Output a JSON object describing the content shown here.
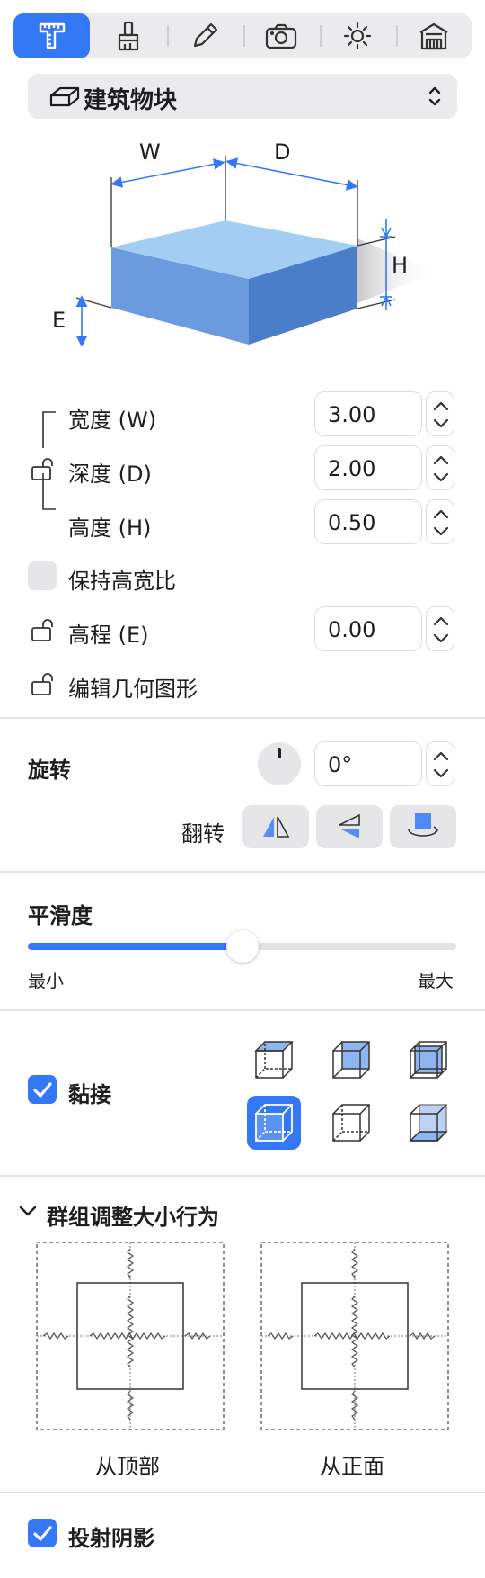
{
  "toolbar": {
    "tools": [
      {
        "icon": "measure-object-icon",
        "active": true
      },
      {
        "icon": "brush-icon",
        "active": false
      },
      {
        "icon": "pencil-icon",
        "active": false
      },
      {
        "icon": "camera-icon",
        "active": false
      },
      {
        "icon": "sun-icon",
        "active": false
      },
      {
        "icon": "storefront-icon",
        "active": false
      }
    ]
  },
  "object_type": {
    "label": "建筑物块",
    "icon": "block-icon"
  },
  "diagram": {
    "w": "W",
    "d": "D",
    "h": "H",
    "e": "E"
  },
  "dimensions": {
    "width": {
      "label": "宽度 (W)",
      "value": "3.00"
    },
    "depth": {
      "label": "深度 (D)",
      "value": "2.00"
    },
    "height": {
      "label": "高度 (H)",
      "value": "0.50"
    },
    "keep_ratio": {
      "label": "保持高宽比",
      "checked": false
    },
    "elevation": {
      "label": "高程 (E)",
      "value": "0.00"
    },
    "edit_geometry": {
      "label": "编辑几何图形"
    }
  },
  "rotation": {
    "title": "旋转",
    "value": "0°",
    "flip_label": "翻转"
  },
  "smoothness": {
    "title": "平滑度",
    "min_label": "最小",
    "max_label": "最大",
    "level": 0.5
  },
  "snap": {
    "label": "黏接",
    "checked": true,
    "selected_index": 3
  },
  "group_resize": {
    "title": "群组调整大小行为",
    "top_label": "从顶部",
    "front_label": "从正面"
  },
  "shadow": {
    "label": "投射阴影",
    "checked": true
  },
  "colors": {
    "accent": "#3478f6",
    "block_top": "#9fc7f1",
    "block_front": "#6b9bde",
    "block_side": "#4a7ec9"
  }
}
